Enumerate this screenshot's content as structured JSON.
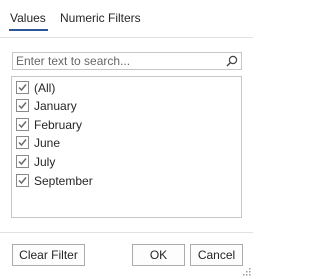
{
  "tabs": {
    "values_label": "Values",
    "numeric_filters_label": "Numeric Filters"
  },
  "search": {
    "placeholder": "Enter text to search...",
    "value": ""
  },
  "list": {
    "items": [
      {
        "label": "(All)",
        "checked": true
      },
      {
        "label": "January",
        "checked": true
      },
      {
        "label": "February",
        "checked": true
      },
      {
        "label": "June",
        "checked": true
      },
      {
        "label": "July",
        "checked": true
      },
      {
        "label": "September",
        "checked": true
      }
    ]
  },
  "buttons": {
    "clear_filter_label": "Clear Filter",
    "ok_label": "OK",
    "cancel_label": "Cancel"
  },
  "colors": {
    "accent": "#2b579a",
    "checkmark": "#6b6b6b"
  },
  "icons": {
    "search": "search-icon",
    "check": "check-icon",
    "resize": "resize-grip-icon"
  }
}
